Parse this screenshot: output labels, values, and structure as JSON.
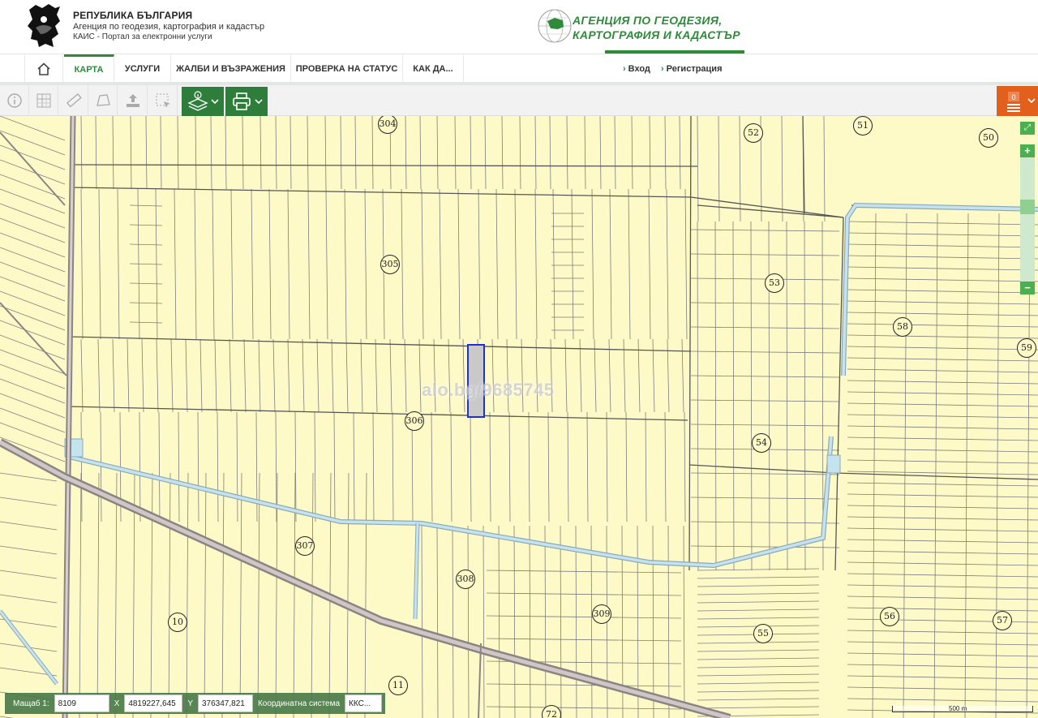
{
  "header": {
    "country": "РЕПУБЛИКА БЪЛГАРИЯ",
    "agency": "Агенция по геодезия, картография и кадастър",
    "portal": "КАИС - Портал за електронни услуги",
    "logo_line1": "АГЕНЦИЯ ПО ГЕОДЕЗИЯ,",
    "logo_line2": "КАРТОГРАФИЯ И КАДАСТЪР"
  },
  "nav": {
    "items": [
      {
        "label": "КАРТА",
        "active": true
      },
      {
        "label": "УСЛУГИ"
      },
      {
        "label": "ЖАЛБИ И ВЪЗРАЖЕНИЯ"
      },
      {
        "label": "ПРОВЕРКА НА СТАТУС"
      },
      {
        "label": "КАК ДА..."
      }
    ],
    "login": "Вход",
    "register": "Регистрация"
  },
  "toolbar": {
    "tools": [
      "info-icon",
      "measure-grid-icon",
      "ruler-icon",
      "polygon-icon",
      "upload-icon",
      "select-area-icon"
    ],
    "layers": "layers-icon",
    "print": "print-icon",
    "basket_count": "0"
  },
  "map": {
    "watermark": "alo.bg/9685745",
    "parcel_labels": [
      {
        "n": "304"
      },
      {
        "n": "52"
      },
      {
        "n": "51"
      },
      {
        "n": "50"
      },
      {
        "n": "305"
      },
      {
        "n": "53"
      },
      {
        "n": "58"
      },
      {
        "n": "59"
      },
      {
        "n": "306"
      },
      {
        "n": "54"
      },
      {
        "n": "307"
      },
      {
        "n": "308"
      },
      {
        "n": "309"
      },
      {
        "n": "10"
      },
      {
        "n": "55"
      },
      {
        "n": "56"
      },
      {
        "n": "57"
      },
      {
        "n": "11"
      },
      {
        "n": "72"
      }
    ]
  },
  "statusbar": {
    "scale_label": "Мащаб  1:",
    "scale_value": "8109",
    "x_label": "X",
    "x_value": "4819227,645",
    "y_label": "Y",
    "y_value": "376347,821",
    "crs_label": "Координатна система",
    "crs_value": "ККС..."
  },
  "scale_bar": "500 m",
  "colors": {
    "accent": "#2e8b3a",
    "map_bg": "#fefac7",
    "basket": "#e35f1c",
    "canal": "#b9dbe8"
  }
}
